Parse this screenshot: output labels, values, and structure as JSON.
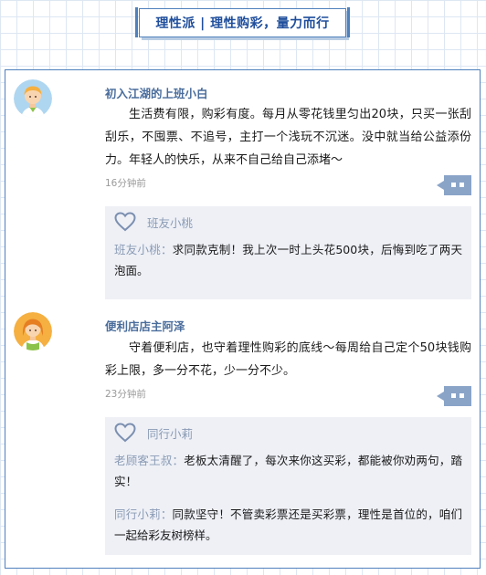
{
  "header": {
    "title": "理性派 | 理性购彩，量力而行"
  },
  "posts": [
    {
      "author": "初入江湖的上班小白",
      "avatar_icon": "boy-avatar-icon",
      "text": "生活费有限，购彩有度。每月从零花钱里匀出20块，只买一张刮刮乐，不囤票、不追号，主打一个浅玩不沉迷。没中就当给公益添份力。年轻人的快乐，从来不自己给自己添堵～",
      "time": "16分钟前",
      "likes": "班友小桃",
      "replies": [
        {
          "name": "班友小桃：",
          "text": "求同款克制！我上次一时上头花500块，后悔到吃了两天泡面。"
        }
      ]
    },
    {
      "author": "便利店店主阿泽",
      "avatar_icon": "girl-avatar-icon",
      "text": "守着便利店，也守着理性购彩的底线～每周给自己定个50块钱购彩上限，多一分不花，少一分不少。",
      "time": "23分钟前",
      "likes": "同行小莉",
      "replies": [
        {
          "name": "老顾客王叔：",
          "text": "老板太清醒了，每次来你这买彩，都能被你劝两句，踏实！"
        },
        {
          "name": "同行小莉：",
          "text": "同款坚守！不管卖彩票还是买彩票，理性是首位的，咱们一起给彩友树榜样。"
        }
      ]
    }
  ],
  "colors": {
    "accent": "#4f81bd",
    "name": "#4a6d9c",
    "reply_name": "#8a9bb5",
    "reply_bg": "#eef0f6",
    "comment_button": "#8aa4c8"
  }
}
